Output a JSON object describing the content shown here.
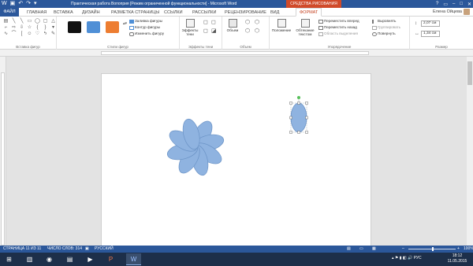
{
  "app": {
    "title": "Практическая работа Вопоприя [Режим ограниченной функциональности] - Microsoft Word",
    "context_header": "СРЕДСТВА РИСОВАНИЯ",
    "user_name": "Елена Ойцева",
    "accent": "#2b579a",
    "context_accent": "#d04a2a"
  },
  "tabs": [
    "ФАЙЛ",
    "ГЛАВНАЯ",
    "ВСТАВКА",
    "ДИЗАЙН",
    "РАЗМЕТКА СТРАНИЦЫ",
    "ССЫЛКИ",
    "РАССЫЛКИ",
    "РЕЦЕНЗИРОВАНИЕ",
    "ВИД",
    "ФОРМАТ"
  ],
  "ribbon": {
    "groups": {
      "insert_shapes": "Вставка фигур",
      "shape_styles": "Стили фигур",
      "shadow_effects": "Эффекты тени",
      "volume": "Объем",
      "arrange": "Упорядочение",
      "size": "Размер"
    },
    "shape_fill": "Заливка фигуры",
    "shape_outline": "Контур фигуры",
    "change_shape": "Изменить фигуру",
    "shadow_effects_btn": "Эффекты тени",
    "volume_btn": "Объем",
    "position_btn": "Положение",
    "wrap_text_btn": "Обтекание текстом",
    "bring_forward": "Переместить вперед",
    "send_backward": "Переместить назад",
    "selection_pane": "Область выделения",
    "align": "Выровнять",
    "group": "Группировать",
    "rotate": "Повернуть",
    "height_value": "2,07 см",
    "width_value": "1,34 см",
    "swatch_colors": [
      "#111111",
      "#4f8fd6",
      "#ed7d31"
    ]
  },
  "status": {
    "page": "СТРАНИЦА 11 ИЗ 11",
    "words": "ЧИСЛО СЛОВ: 314",
    "lang": "РУССКИЙ",
    "zoom": "100%"
  },
  "taskbar": {
    "tray_lang": "РУС",
    "time": "18:12",
    "date": "11.05.2015"
  },
  "drawing": {
    "flower_petals": 8,
    "fill": "#8fb3e0",
    "outline": "#6b93c6"
  }
}
